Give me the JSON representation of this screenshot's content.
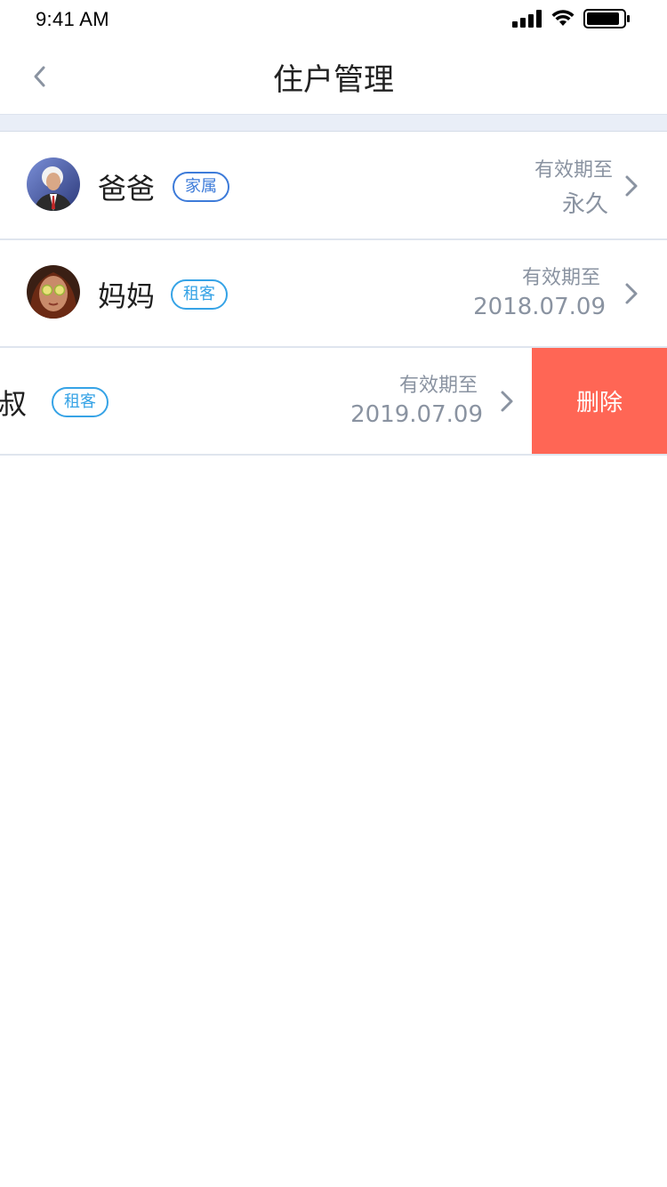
{
  "status_bar": {
    "time": "9:41 AM"
  },
  "header": {
    "title": "住户管理",
    "back_icon": "chevron-left-icon"
  },
  "residents": [
    {
      "name": "爸爸",
      "tag": "家属",
      "valid_label": "有效期至",
      "valid_value": "永久"
    },
    {
      "name": "妈妈",
      "tag": "租客",
      "valid_label": "有效期至",
      "valid_value": "2018.07.09"
    },
    {
      "name": "叔",
      "tag": "租客",
      "valid_label": "有效期至",
      "valid_value": "2019.07.09",
      "delete_label": "删除"
    }
  ],
  "colors": {
    "accent_blue": "#3d7bd9",
    "tenant_blue": "#36a3e6",
    "delete_red": "#ff6655",
    "band": "#e9eef7",
    "muted_text": "#8a93a1"
  }
}
